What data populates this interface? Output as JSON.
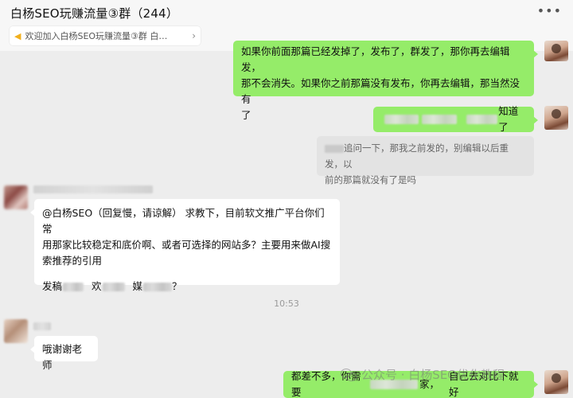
{
  "header": {
    "title": "白杨SEO玩赚流量③群（244）",
    "more_icon": "•••",
    "notice": "欢迎加入白杨SEO玩赚流量③群  白…",
    "notice_chevron": "›"
  },
  "messages": {
    "m1": {
      "line1": "如果你前面那篇已经发掉了，发布了，群发了，那你再去编辑发，",
      "line2": "那不会消失。如果你之前那篇没有发布，你再去编辑，那当然没有",
      "line3": "了"
    },
    "m2": {
      "text_end": "知道了"
    },
    "m3": {
      "line1_tail": "追问一下，那我之前发的，别编辑以后重发，以",
      "line2": "前的那篇就没有了是吗"
    },
    "m4": {
      "line1": "@白杨SEO（回复慢，请谅解） 求教下，目前软文推广平台你们常",
      "line2": "用那家比较稳定和底价啊、或者可选择的网站多？主要用来做AI搜",
      "line3": "索推荐的引用",
      "line4_a": "发稿",
      "line4_b": "欢",
      "line4_c": "媒",
      "line4_d": "？"
    },
    "timestamp": "10:53",
    "m5": {
      "text": "哦谢谢老师"
    },
    "m6": {
      "text_start": "都差不多，你需要",
      "text_mid": "家，",
      "text_end": "自己去对比下就好"
    }
  },
  "watermark": "公众号 · 白杨SEO优化教程",
  "colors": {
    "my_bubble": "#95ec69",
    "other_bubble": "#ffffff",
    "background": "#ededed"
  }
}
